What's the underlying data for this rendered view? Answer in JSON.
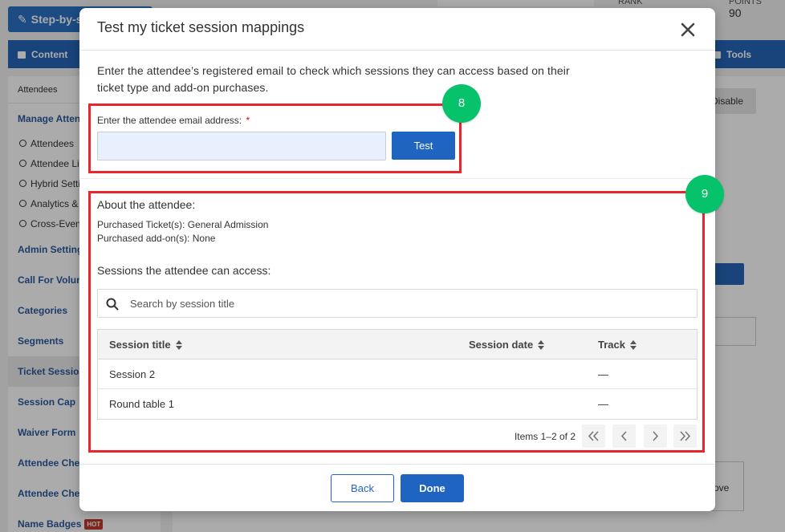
{
  "background": {
    "step_button": "Step-by-ste",
    "content_tab": "Content",
    "tools_tab": "Tools",
    "rank_label": "RANK",
    "points_label": "POINTS",
    "points_value": "90",
    "disable_button": "Disable",
    "remove_fragment": "ove",
    "sidebar": {
      "header": "Attendees",
      "items": [
        {
          "label": "Manage Atten",
          "type": "group"
        },
        {
          "label": "Attendees",
          "type": "sub"
        },
        {
          "label": "Attendee Lis",
          "type": "sub"
        },
        {
          "label": "Hybrid Settin",
          "type": "sub"
        },
        {
          "label": "Analytics &",
          "type": "sub"
        },
        {
          "label": "Cross-Even",
          "type": "sub"
        },
        {
          "label": "Admin Setting",
          "type": "group"
        },
        {
          "label": "Call For Volun",
          "type": "group"
        },
        {
          "label": "Categories",
          "type": "group"
        },
        {
          "label": "Segments",
          "type": "group"
        },
        {
          "label": "Ticket Session",
          "type": "group",
          "active": true
        },
        {
          "label": "Session Cap",
          "type": "group"
        },
        {
          "label": "Waiver Form",
          "type": "group"
        },
        {
          "label": "Attendee Chec",
          "type": "group"
        },
        {
          "label": "Attendee Chec",
          "type": "group"
        },
        {
          "label": "Name Badges",
          "type": "group",
          "badge": "HOT"
        }
      ]
    }
  },
  "modal": {
    "title": "Test my ticket session mappings",
    "intro": "Enter the attendee’s registered email to check which sessions they can access based on their ticket type and add-on purchases.",
    "email_label": "Enter the attendee email address:",
    "required_mark": "*",
    "email_value": "",
    "test_button": "Test",
    "about_title": "About the attendee:",
    "ticket_label": "Purchased Ticket(s):",
    "ticket_value": "General Admission",
    "addon_label": "Purchased add-on(s):",
    "addon_value": "None",
    "sessions_title": "Sessions the attendee can access:",
    "search_placeholder": "Search by session title",
    "columns": [
      "Session title",
      "Session date",
      "Track"
    ],
    "rows": [
      {
        "title": "Session 2",
        "date": "",
        "track": "—"
      },
      {
        "title": "Round table 1",
        "date": "",
        "track": "—"
      }
    ],
    "pager_info": "Items 1–2 of 2",
    "back_button": "Back",
    "done_button": "Done"
  },
  "annotations": {
    "step_8": "8",
    "step_9": "9",
    "highlight_color": "#e8262e",
    "badge_color": "#06c26a"
  },
  "colors": {
    "primary": "#1f64c0",
    "input_bg": "#e8f0fd"
  }
}
